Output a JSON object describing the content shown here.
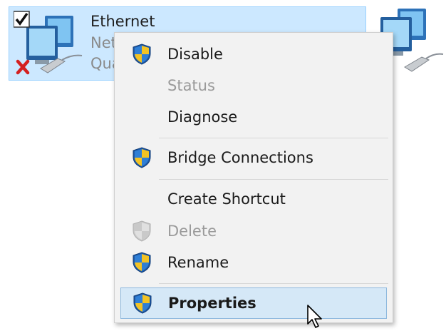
{
  "connection": {
    "name": "Ethernet",
    "line2": "Net",
    "line3": "Qua",
    "selected": true,
    "checked": true,
    "status_icon": "disconnected-x-icon"
  },
  "menu": {
    "items": [
      {
        "label": "Disable",
        "shield": true,
        "disabled": false,
        "bold": false,
        "highlighted": false
      },
      {
        "label": "Status",
        "shield": false,
        "disabled": true,
        "bold": false,
        "highlighted": false
      },
      {
        "label": "Diagnose",
        "shield": false,
        "disabled": false,
        "bold": false,
        "highlighted": false
      },
      {
        "label": "Bridge Connections",
        "shield": true,
        "disabled": false,
        "bold": false,
        "highlighted": false
      },
      {
        "label": "Create Shortcut",
        "shield": false,
        "disabled": false,
        "bold": false,
        "highlighted": false
      },
      {
        "label": "Delete",
        "shield": true,
        "disabled": true,
        "bold": false,
        "highlighted": false
      },
      {
        "label": "Rename",
        "shield": true,
        "disabled": false,
        "bold": false,
        "highlighted": false
      },
      {
        "label": "Properties",
        "shield": true,
        "disabled": false,
        "bold": true,
        "highlighted": true
      }
    ]
  },
  "colors": {
    "selection_bg": "#cce8ff",
    "menu_bg": "#f2f2f2",
    "menu_highlight": "#d5e8f7",
    "disabled_text": "#9a9a9a"
  },
  "icons": {
    "network_adapter": "network-adapter-icon",
    "uac_shield": "uac-shield-icon",
    "cursor": "mouse-pointer-icon"
  }
}
